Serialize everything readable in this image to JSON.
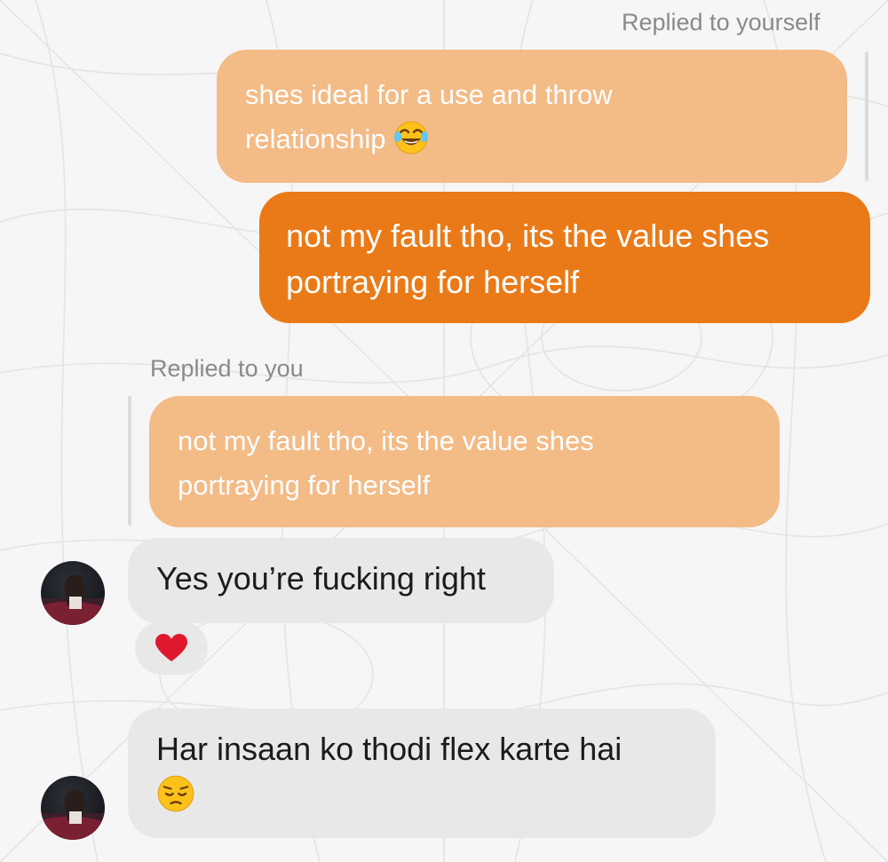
{
  "conversation": {
    "reply_to_yourself_label": "Replied to yourself",
    "quoted_self_message": {
      "line1": "shes ideal for a use and throw",
      "line2": "relationship",
      "emoji": "face-with-tears-of-joy"
    },
    "sent_message": {
      "line1": "not my fault tho, its the value shes",
      "line2": "portraying for herself"
    },
    "reply_to_you_label": "Replied to you",
    "quoted_your_message": {
      "line1": "not my fault tho, its the value shes",
      "line2": "portraying for herself"
    },
    "received_message_1": {
      "text": "Yes you’re fucking right",
      "reaction": "red-heart"
    },
    "received_message_2": {
      "text": "Har insaan ko thodi flex karte hai",
      "emoji": "pensive-face"
    }
  },
  "colors": {
    "background": "#f6f6f6",
    "sent_bubble": "#ea7a17",
    "quoted_bubble": "#f3bb86",
    "received_bubble": "#e8e8e8",
    "label_text": "#8a8a8a"
  }
}
